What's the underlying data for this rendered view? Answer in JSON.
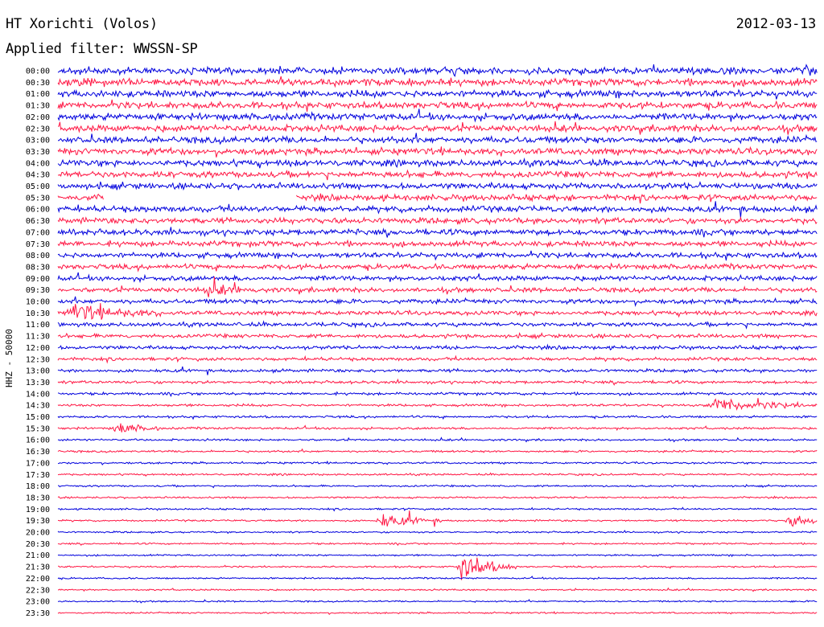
{
  "header": {
    "station": "HT Xorichti (Volos)",
    "date": "2012-03-13",
    "filter": "Applied filter: WWSSN-SP"
  },
  "colors": {
    "trace_a": "#0000dd",
    "trace_b": "#ff1744",
    "background": "#ffffff"
  },
  "chart_data": {
    "type": "line",
    "title": "",
    "ylabel": "HHZ - 50000",
    "xlabel": "",
    "grid": false,
    "row_labels": [
      "00:00",
      "00:30",
      "01:00",
      "01:30",
      "02:00",
      "02:30",
      "03:00",
      "03:30",
      "04:00",
      "04:30",
      "05:00",
      "05:30",
      "06:00",
      "06:30",
      "07:00",
      "07:30",
      "08:00",
      "08:30",
      "09:00",
      "09:30",
      "10:00",
      "10:30",
      "11:00",
      "11:30",
      "12:00",
      "12:30",
      "13:00",
      "13:30",
      "14:00",
      "14:30",
      "15:00",
      "15:30",
      "16:00",
      "16:30",
      "17:00",
      "17:30",
      "18:00",
      "18:30",
      "19:00",
      "19:30",
      "20:00",
      "20:30",
      "21:00",
      "21:30",
      "22:00",
      "22:30",
      "23:00",
      "23:30"
    ],
    "row_colors": [
      "trace_a",
      "trace_b"
    ],
    "row_minutes": 30,
    "noise_amplitude": [
      3.2,
      3.2,
      3.1,
      3.0,
      3.0,
      3.0,
      2.9,
      2.9,
      2.8,
      2.8,
      2.7,
      2.7,
      2.7,
      2.6,
      2.6,
      2.5,
      2.4,
      2.3,
      2.2,
      2.1,
      2.0,
      1.9,
      1.8,
      1.7,
      1.6,
      1.5,
      1.4,
      1.3,
      1.2,
      1.1,
      1.0,
      1.0,
      0.9,
      0.9,
      0.85,
      0.85,
      0.8,
      0.8,
      0.8,
      0.8,
      0.75,
      0.75,
      0.75,
      0.75,
      0.7,
      0.7,
      0.7,
      0.7
    ],
    "events": [
      {
        "row": 19,
        "minute": 5.8,
        "amplitude": 2.5,
        "duration": 1.0
      },
      {
        "row": 21,
        "minute": 0.5,
        "amplitude": 4.0,
        "duration": 1.6
      },
      {
        "row": 29,
        "minute": 25.9,
        "amplitude": 3.5,
        "duration": 1.8
      },
      {
        "row": 31,
        "minute": 2.3,
        "amplitude": 3.0,
        "duration": 0.8
      },
      {
        "row": 39,
        "minute": 12.7,
        "amplitude": 3.5,
        "duration": 1.2
      },
      {
        "row": 39,
        "minute": 28.9,
        "amplitude": 3.0,
        "duration": 1.0
      },
      {
        "row": 43,
        "minute": 15.9,
        "amplitude": 7.0,
        "duration": 1.0
      }
    ],
    "gaps": [
      {
        "row": 11,
        "minute_start": 1.8,
        "minute_end": 9.4
      }
    ]
  }
}
